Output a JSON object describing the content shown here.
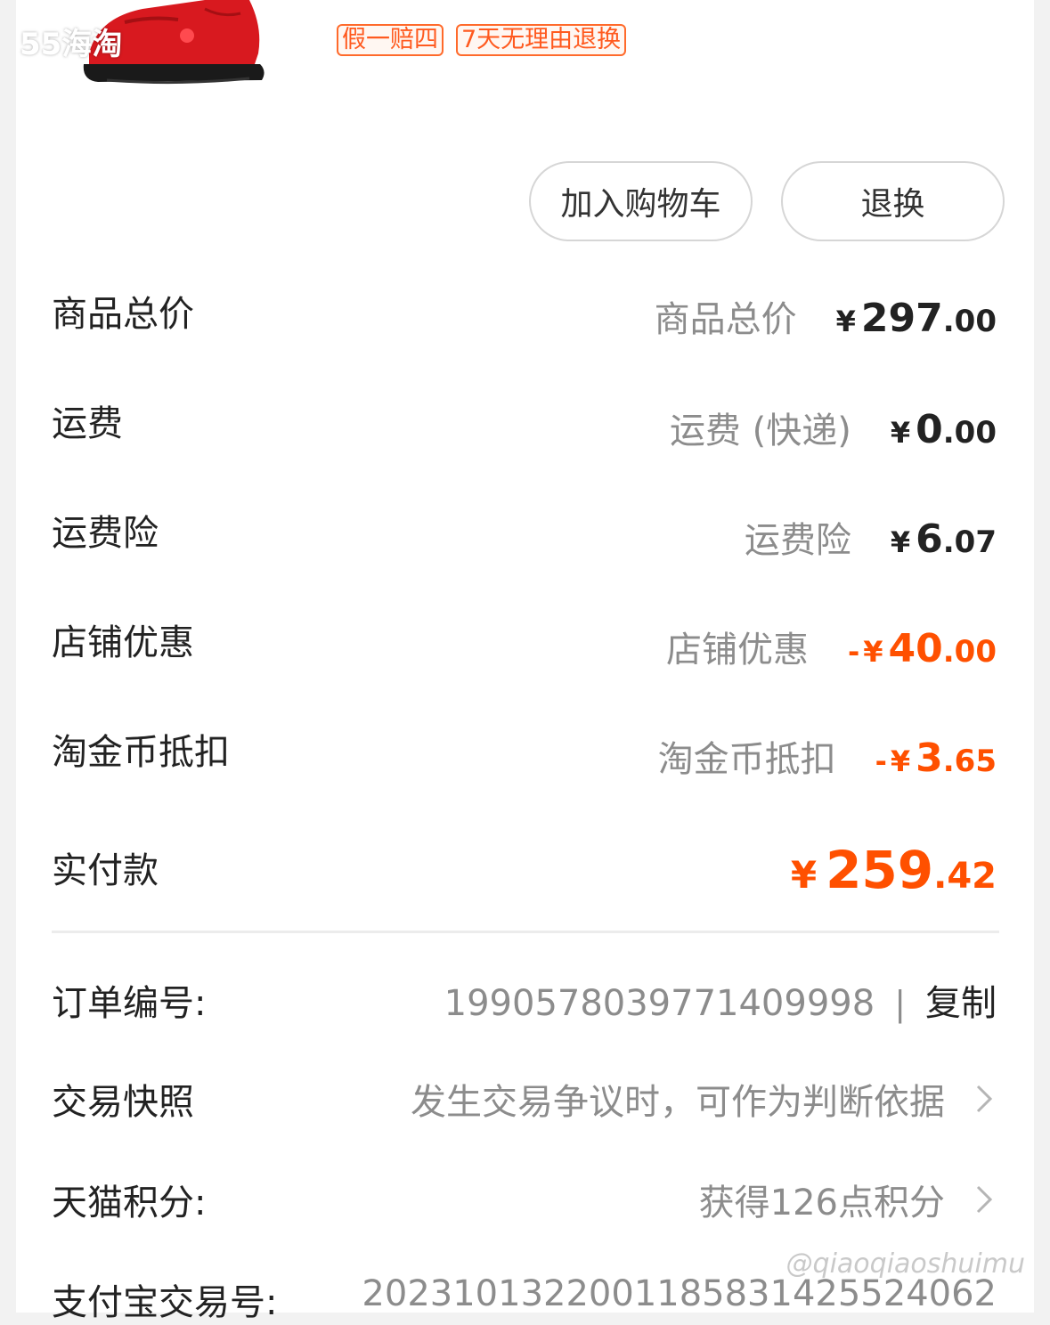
{
  "watermark": {
    "top_left": "55海淘",
    "bottom_right": "@qiaoqiaoshuimu"
  },
  "product": {
    "image_icon": "red-dance-sneaker-image",
    "tags": [
      "假一赔四",
      "7天无理由退换"
    ]
  },
  "actions": {
    "add_to_cart": "加入购物车",
    "return_exchange": "退换"
  },
  "price_rows": [
    {
      "label": "商品总价",
      "sublabel": "商品总价",
      "prefix": "",
      "currency": "¥",
      "int": "297",
      "dec": ".00",
      "color": "#222222"
    },
    {
      "label": "运费",
      "sublabel": "运费 (快递)",
      "prefix": "",
      "currency": "¥",
      "int": "0",
      "dec": ".00",
      "color": "#222222"
    },
    {
      "label": "运费险",
      "sublabel": "运费险",
      "prefix": "",
      "currency": "¥",
      "int": "6",
      "dec": ".07",
      "color": "#222222"
    },
    {
      "label": "店铺优惠",
      "sublabel": "店铺优惠",
      "prefix": "-",
      "currency": "¥",
      "int": "40",
      "dec": ".00",
      "color": "#ff5000"
    },
    {
      "label": "淘金币抵扣",
      "sublabel": "淘金币抵扣",
      "prefix": "-",
      "currency": "¥",
      "int": "3",
      "dec": ".65",
      "color": "#ff5000"
    }
  ],
  "total": {
    "label": "实付款",
    "currency": "¥",
    "int": "259",
    "dec": ".42",
    "color": "#ff5000"
  },
  "info": {
    "order_no": {
      "label": "订单编号:",
      "value": "1990578039771409998",
      "separator": "|",
      "copy": "复制"
    },
    "snapshot": {
      "label": "交易快照",
      "value": "发生交易争议时，可作为判断依据"
    },
    "points": {
      "label": "天猫积分:",
      "value": "获得126点积分"
    },
    "alipay": {
      "label": "支付宝交易号:",
      "value": "2023101322001185831425524062"
    }
  }
}
